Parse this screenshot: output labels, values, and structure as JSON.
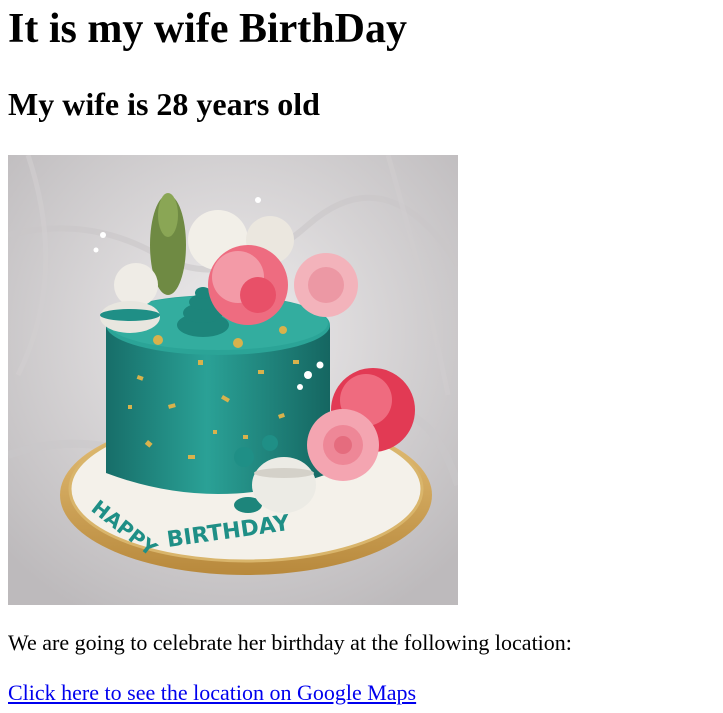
{
  "page": {
    "heading": "It is my wife BirthDay",
    "subheading": "My wife is 28 years old",
    "cake_photo": {
      "icon": "birthday-cake-photo",
      "piping_text": "HAPPY BIRTHDAY",
      "colors": {
        "background": "#d9d6d8",
        "cake": "#1f8f86",
        "board": "#d3a65a",
        "flower_pink": "#f08a9c",
        "flower_red": "#e23a54"
      }
    },
    "description": "We are going to celebrate her birthday at the following location:",
    "link_text": "Click here to see the location on Google Maps",
    "link_color": "#0000ee"
  }
}
